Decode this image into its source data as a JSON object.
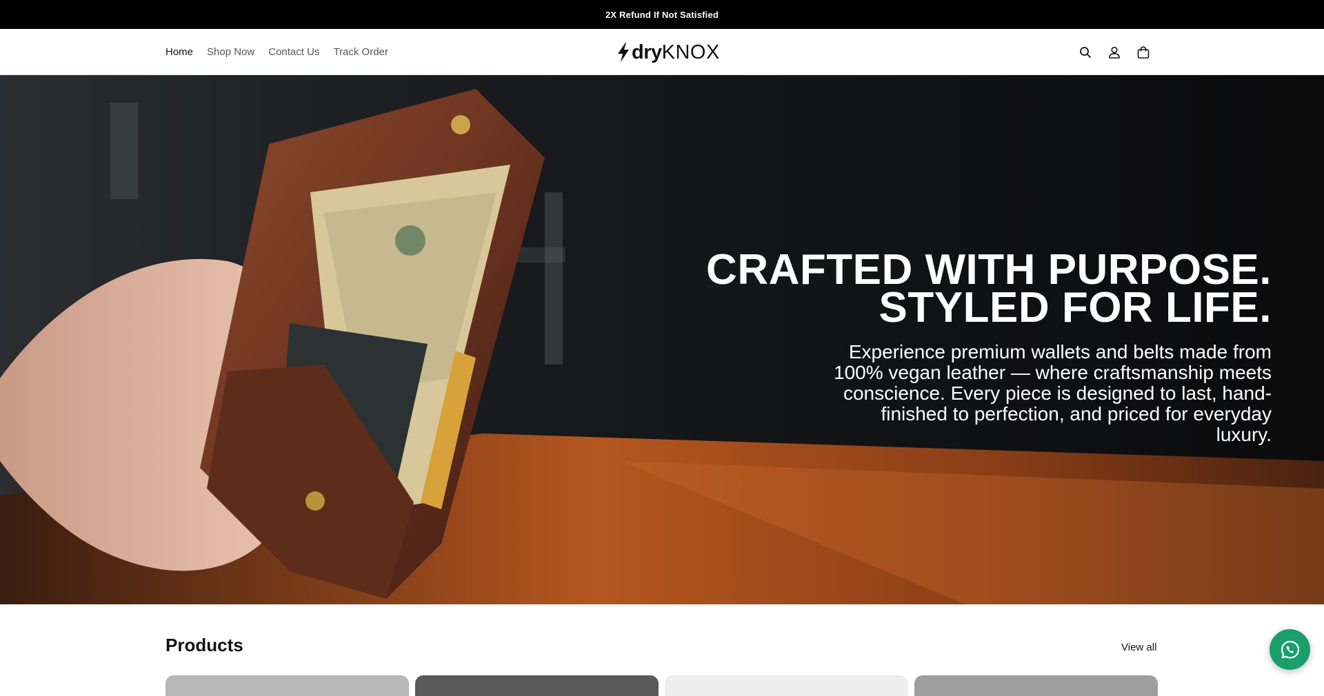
{
  "announcement": {
    "text": "2X Refund If Not Satisfied"
  },
  "header": {
    "nav": [
      {
        "label": "Home",
        "active": true
      },
      {
        "label": "Shop Now",
        "active": false
      },
      {
        "label": "Contact Us",
        "active": false
      },
      {
        "label": "Track Order",
        "active": false
      }
    ],
    "logo": {
      "part1": "dry",
      "part2": "KNOX",
      "icon": "lightning-bolt-icon"
    },
    "icons": [
      "search-icon",
      "account-icon",
      "cart-icon"
    ]
  },
  "hero": {
    "title_line1": "CRAFTED WITH PURPOSE.",
    "title_line2": "STYLED FOR LIFE.",
    "subtitle": "Experience premium wallets and belts made from 100% vegan leather — where craftsmanship meets conscience. Every piece is designed to last, hand-finished to perfection, and priced for everyday luxury.",
    "image": "hand-holding-leather-wallet-photo"
  },
  "products": {
    "title": "Products",
    "view_all": "View all",
    "card_tones": [
      "#b7b7b7",
      "#5a5a5a",
      "#eeeeee",
      "#9e9e9e"
    ]
  },
  "whatsapp": {
    "icon": "whatsapp-icon"
  },
  "colors": {
    "announcement_bg": "#000000",
    "whatsapp": "#1a9e6e"
  }
}
